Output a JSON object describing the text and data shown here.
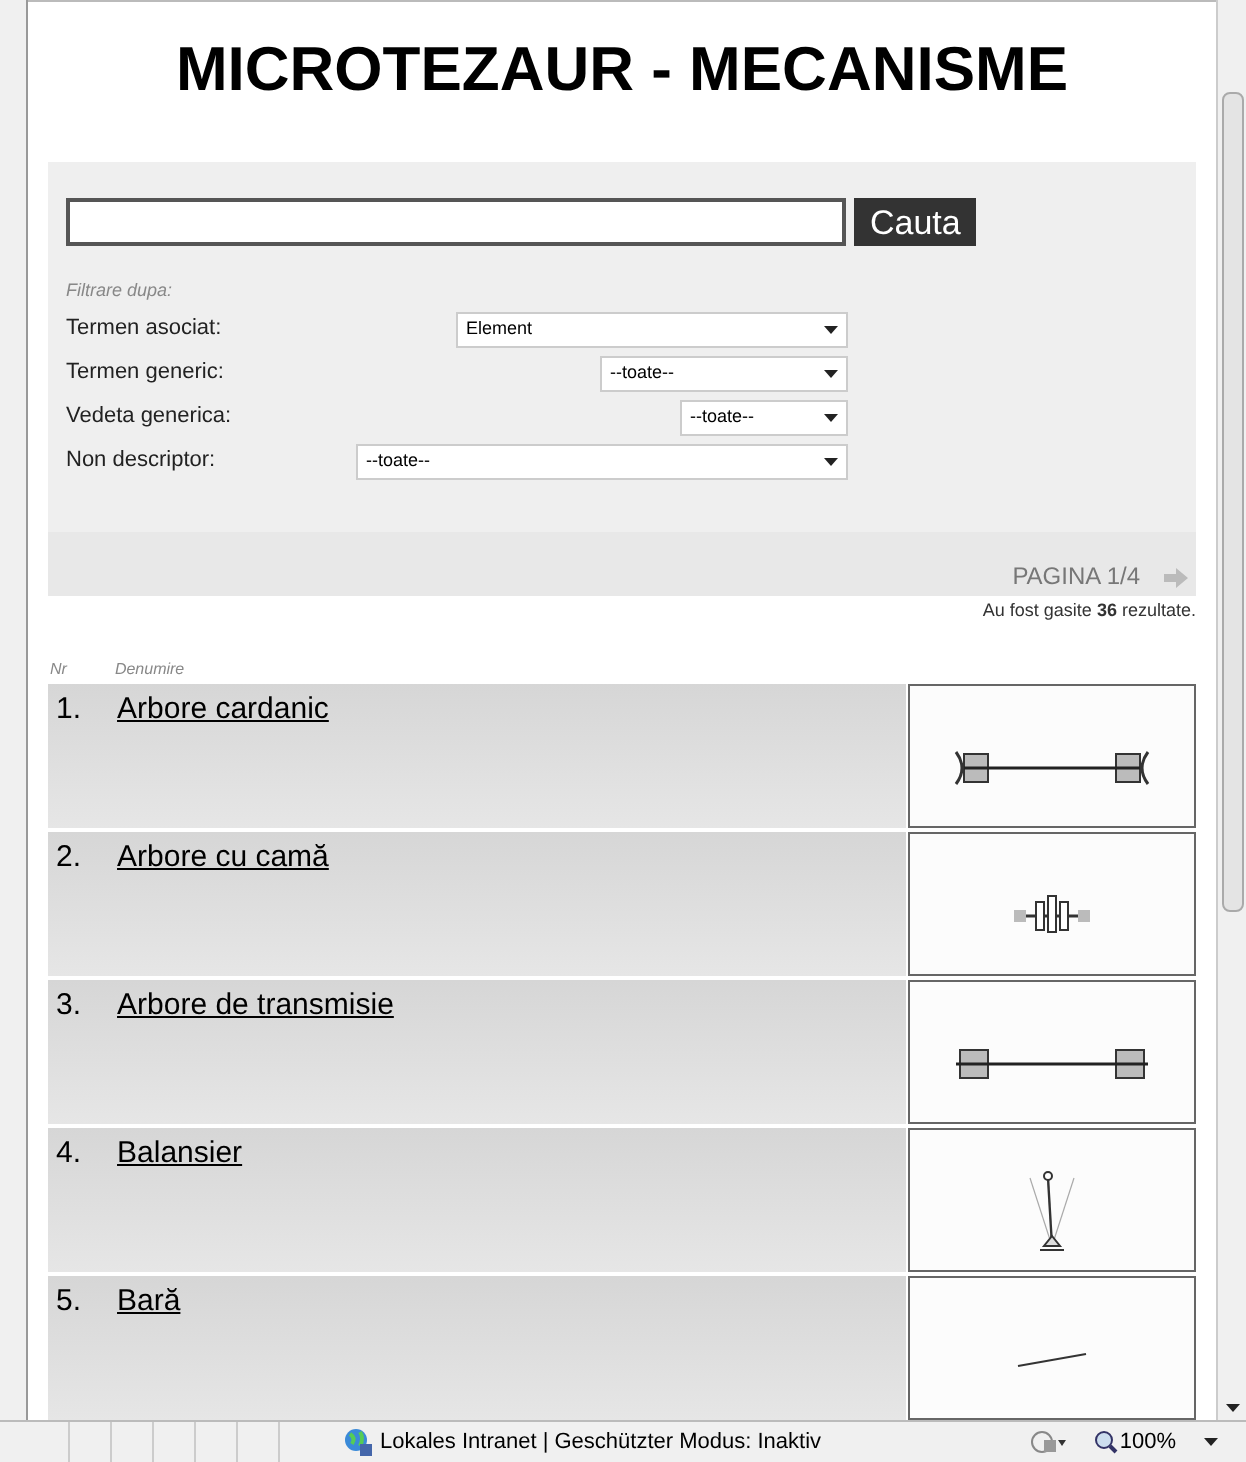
{
  "title": "MICROTEZAUR - MECANISME",
  "search": {
    "button": "Cauta"
  },
  "filters": {
    "caption": "Filtrare dupa:",
    "fields": [
      {
        "label": "Termen asociat:",
        "value": "Element"
      },
      {
        "label": "Termen generic:",
        "value": "--toate--"
      },
      {
        "label": "Vedeta generica:",
        "value": "--toate--"
      },
      {
        "label": "Non descriptor:",
        "value": "--toate--"
      }
    ]
  },
  "pagination": {
    "label": "PAGINA 1/4",
    "results": "Au fost gasite **36** rezultate."
  },
  "columns": [
    "Nr",
    "Denumire"
  ],
  "results": [
    {
      "nr": "1.",
      "name": "Arbore cardanic"
    },
    {
      "nr": "2.",
      "name": "Arbore cu camă"
    },
    {
      "nr": "3.",
      "name": "Arbore de transmisie"
    },
    {
      "nr": "4.",
      "name": "Balansier"
    },
    {
      "nr": "5.",
      "name": "Bară"
    }
  ],
  "status_bar": {
    "zone": "Lokales Intranet | Geschützter Modus: Inaktiv",
    "zoom": "100%"
  }
}
